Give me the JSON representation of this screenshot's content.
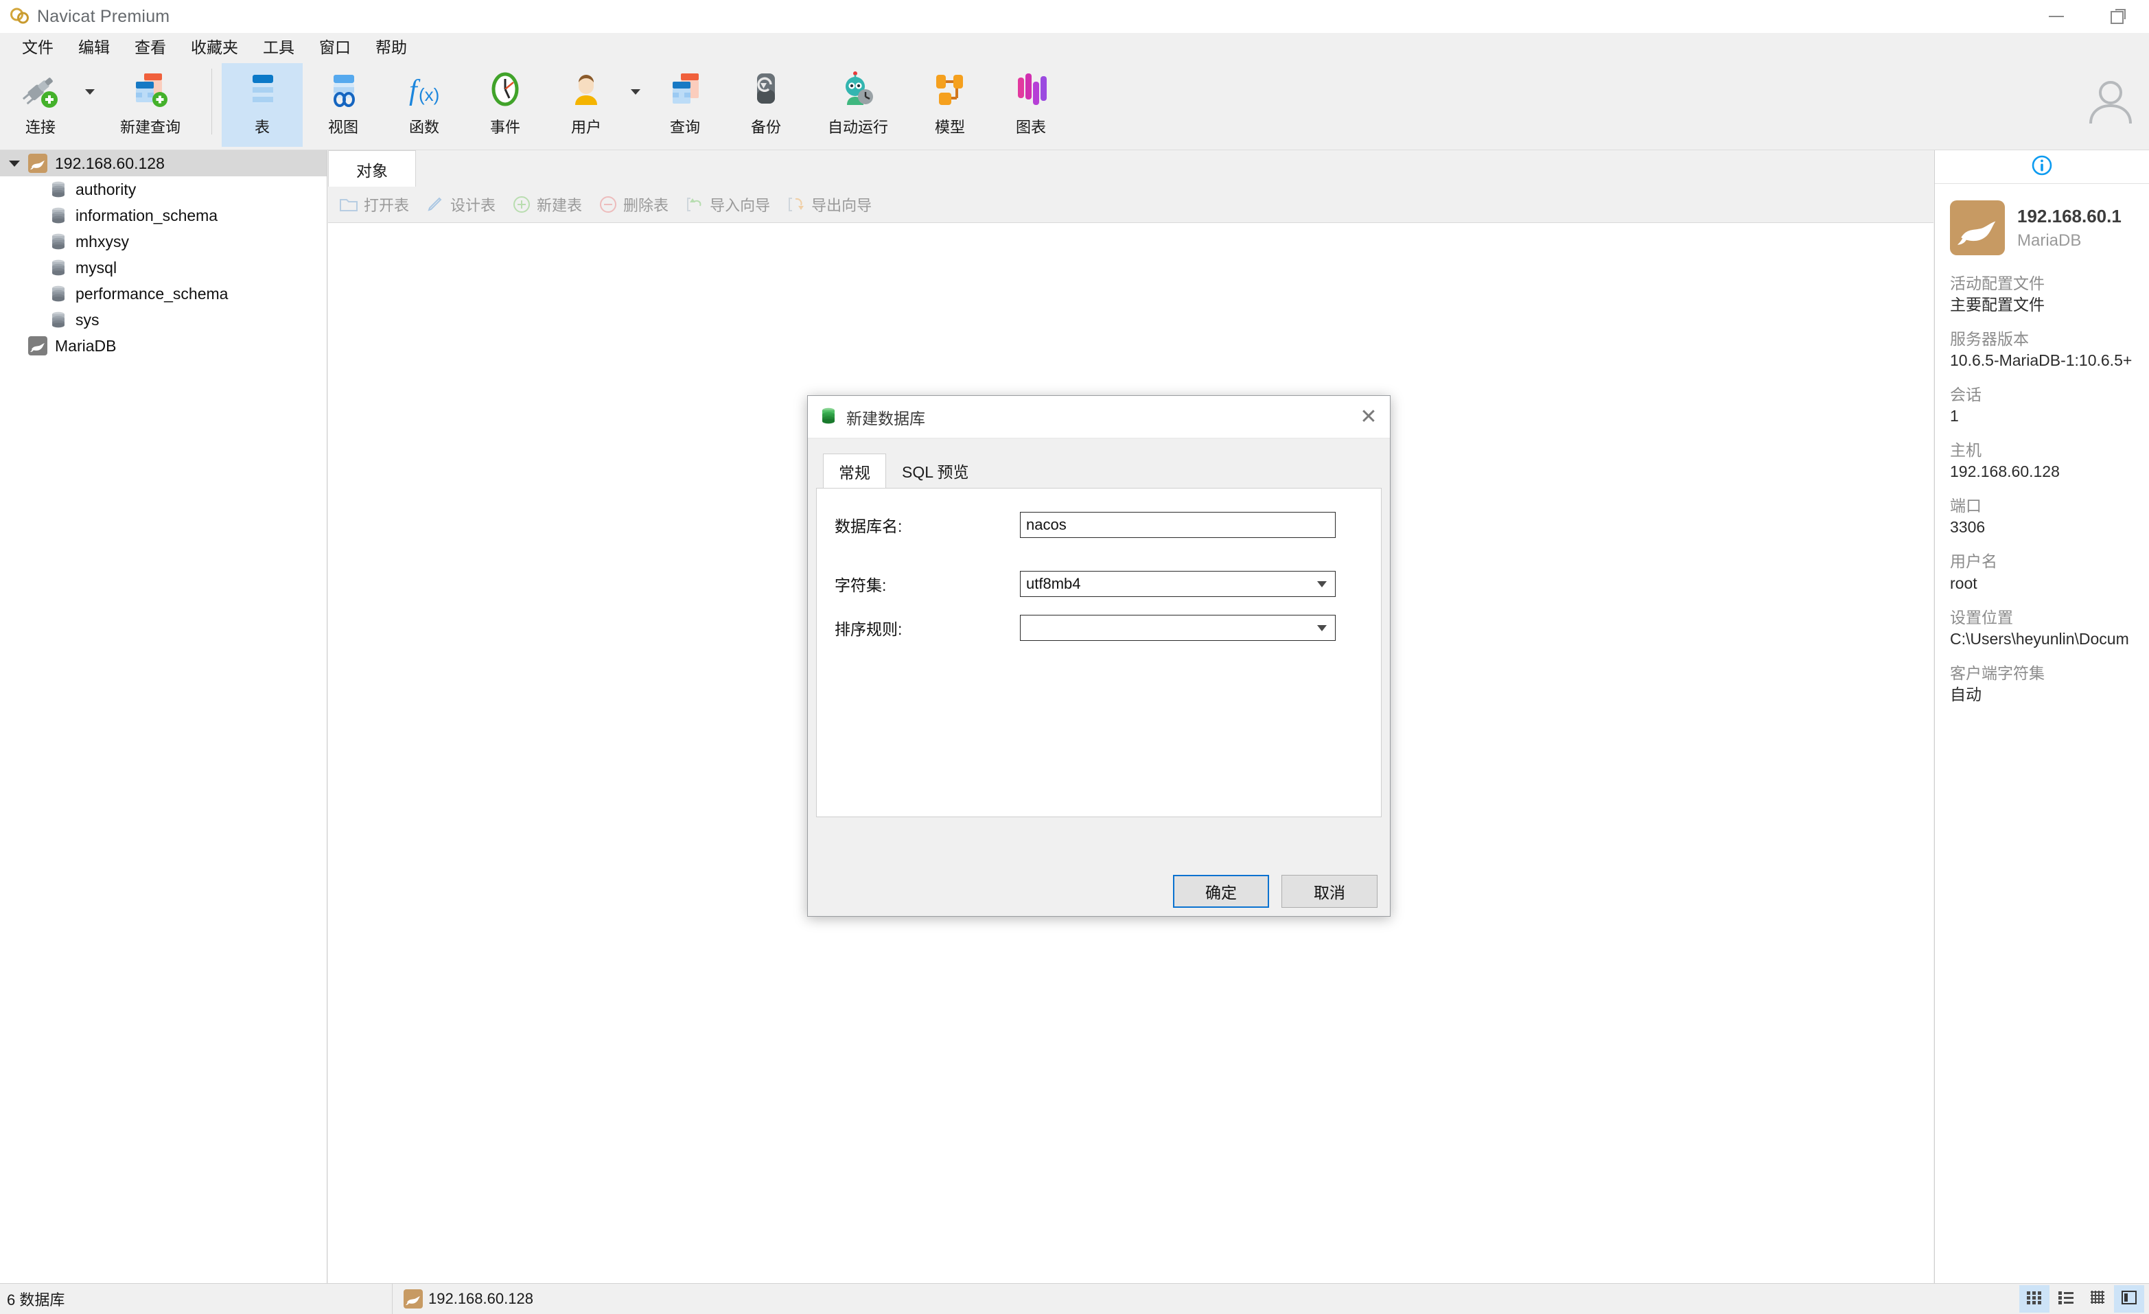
{
  "window": {
    "app_title": "Navicat Premium",
    "logo_icon": "navicat-logo-icon",
    "minimize_label": "minimize",
    "restore_label": "restore"
  },
  "menubar": {
    "items": [
      {
        "label": "文件",
        "name": "menu-file"
      },
      {
        "label": "编辑",
        "name": "menu-edit"
      },
      {
        "label": "查看",
        "name": "menu-view"
      },
      {
        "label": "收藏夹",
        "name": "menu-favorites"
      },
      {
        "label": "工具",
        "name": "menu-tools"
      },
      {
        "label": "窗口",
        "name": "menu-window"
      },
      {
        "label": "帮助",
        "name": "menu-help"
      }
    ]
  },
  "toolbar": {
    "group_left": [
      {
        "label": "连接",
        "icon": "connection-plug-add-icon",
        "has_caret": true
      },
      {
        "label": "新建查询",
        "icon": "new-query-icon",
        "has_caret": false
      }
    ],
    "group_right": [
      {
        "label": "表",
        "icon": "table-icon",
        "active": true,
        "has_caret": false
      },
      {
        "label": "视图",
        "icon": "view-icon",
        "active": false,
        "has_caret": false
      },
      {
        "label": "函数",
        "icon": "function-fx-icon",
        "active": false,
        "has_caret": false
      },
      {
        "label": "事件",
        "icon": "event-clock-icon",
        "active": false,
        "has_caret": false
      },
      {
        "label": "用户",
        "icon": "user-icon",
        "active": false,
        "has_caret": true
      },
      {
        "label": "查询",
        "icon": "query-icon",
        "active": false,
        "has_caret": false
      },
      {
        "label": "备份",
        "icon": "backup-icon",
        "active": false,
        "has_caret": false
      },
      {
        "label": "自动运行",
        "icon": "automation-robot-icon",
        "active": false,
        "has_caret": false
      },
      {
        "label": "模型",
        "icon": "model-icon",
        "active": false,
        "has_caret": false
      },
      {
        "label": "图表",
        "icon": "chart-icon",
        "active": false,
        "has_caret": false
      }
    ],
    "avatar_icon": "user-avatar-icon"
  },
  "sidebar": {
    "connection": {
      "label": "192.168.60.128",
      "icon": "mariadb-seal-icon",
      "expanded": true,
      "selected": true
    },
    "databases": [
      {
        "label": "authority",
        "icon": "database-icon"
      },
      {
        "label": "information_schema",
        "icon": "database-icon"
      },
      {
        "label": "mhxysy",
        "icon": "database-icon"
      },
      {
        "label": "mysql",
        "icon": "database-icon"
      },
      {
        "label": "performance_schema",
        "icon": "database-icon"
      },
      {
        "label": "sys",
        "icon": "database-icon"
      }
    ],
    "second_connection": {
      "label": "MariaDB",
      "icon": "mariadb-seal-gray-icon"
    }
  },
  "content": {
    "tabs": [
      {
        "label": "对象",
        "active": true
      }
    ],
    "object_toolbar": [
      {
        "label": "打开表",
        "icon": "open-table-folder-icon"
      },
      {
        "label": "设计表",
        "icon": "design-table-pencil-icon"
      },
      {
        "label": "新建表",
        "icon": "new-table-plus-icon"
      },
      {
        "label": "删除表",
        "icon": "delete-table-minus-icon"
      },
      {
        "label": "导入向导",
        "icon": "import-wizard-icon"
      },
      {
        "label": "导出向导",
        "icon": "export-wizard-icon"
      }
    ],
    "search_icon": "search-icon"
  },
  "info_panel": {
    "tab_icon": "info-circle-icon",
    "seal_icon": "mariadb-seal-icon",
    "title": "192.168.60.1",
    "subtitle": "MariaDB",
    "fields": [
      {
        "key": "活动配置文件",
        "value": "主要配置文件"
      },
      {
        "key": "服务器版本",
        "value": "10.6.5-MariaDB-1:10.6.5+"
      },
      {
        "key": "会话",
        "value": "1"
      },
      {
        "key": "主机",
        "value": "192.168.60.128"
      },
      {
        "key": "端口",
        "value": "3306"
      },
      {
        "key": "用户名",
        "value": "root"
      },
      {
        "key": "设置位置",
        "value": "C:\\Users\\heyunlin\\Docum"
      },
      {
        "key": "客户端字符集",
        "value": "自动"
      }
    ]
  },
  "statusbar": {
    "left_text": "6 数据库",
    "connection_icon": "mariadb-seal-icon",
    "connection_text": "192.168.60.128",
    "view_buttons": [
      {
        "name": "grid-view-button",
        "icon": "grid-view-icon",
        "active": true
      },
      {
        "name": "list-view-button",
        "icon": "list-view-icon",
        "active": false
      },
      {
        "name": "detail-view-button",
        "icon": "detail-grid-icon",
        "active": false
      },
      {
        "name": "toggle-info-panel-button",
        "icon": "info-panel-toggle-icon",
        "active": true
      }
    ]
  },
  "dialog": {
    "title": "新建数据库",
    "title_icon": "database-green-icon",
    "close_icon": "close-icon",
    "tabs": [
      {
        "label": "常规",
        "active": true
      },
      {
        "label": "SQL 预览",
        "active": false
      }
    ],
    "fields": {
      "db_name_label": "数据库名:",
      "db_name_value": "nacos",
      "charset_label": "字符集:",
      "charset_value": "utf8mb4",
      "collation_label": "排序规则:",
      "collation_value": ""
    },
    "buttons": {
      "ok": "确定",
      "cancel": "取消"
    }
  }
}
